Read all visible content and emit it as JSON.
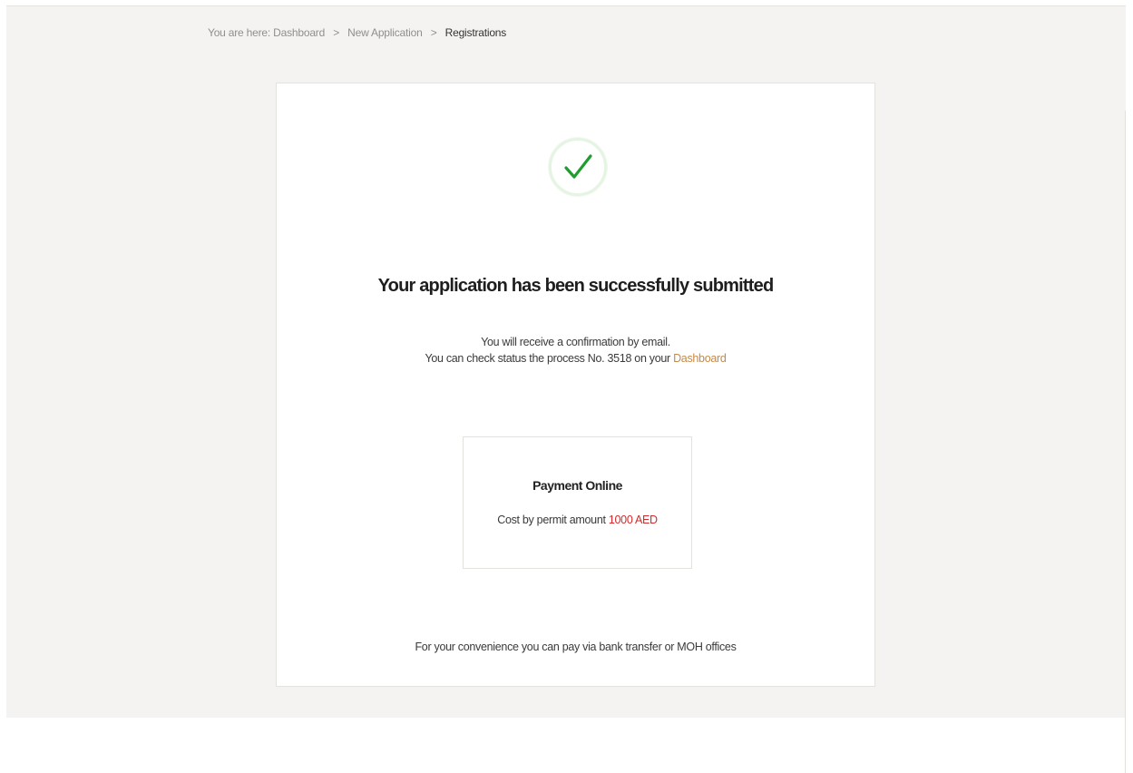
{
  "breadcrumb": {
    "prefix": "You are here:",
    "items": [
      "Dashboard",
      "New Application",
      "Registrations"
    ],
    "separator": ">"
  },
  "status": {
    "icon": "checkmark-icon",
    "color": "#1f9d2e",
    "title": "Your application has been successfully submitted",
    "line1": "You will receive a confirmation by email.",
    "line2_prefix": "You can check status the process No. 3518 on your",
    "line2_link": "Dashboard",
    "link_color": "#c48a4a"
  },
  "payment": {
    "title": "Payment Online",
    "cost_label": "Cost by permit amount",
    "amount": "1000 AED",
    "amount_color": "#d12b2b"
  },
  "footnote": "For your convenience you can pay via bank transfer or MOH offices"
}
